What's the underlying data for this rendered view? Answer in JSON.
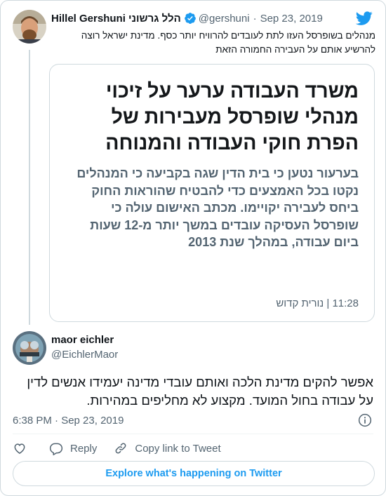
{
  "colors": {
    "accent": "#1d9bf0",
    "text": "#0f1419",
    "muted": "#536471",
    "border": "#cfd9de"
  },
  "parent_tweet": {
    "author_name": "Hillel Gershuni הלל גרשוני",
    "handle": "@gershuni",
    "date": "Sep 23, 2019",
    "text": "מנהלים בשופרסל העזו לתת לעובדים להרוויח יותר כסף. מדינת ישראל רוצה להרשיע אותם על העבירה החמורה הזאת",
    "link_card": {
      "title": "משרד העבודה ערער על זיכוי מנהלי שופרסל מעבירות של הפרת חוקי העבודה והמנוחה",
      "body": "בערעור נטען כי בית הדין שגה בקביעה כי המנהלים נקטו בכל האמצעים כדי להבטיח שהוראות החוק ביחס לעבירה יקויימו. מכתב האישום עולה כי שופרסל העסיקה עובדים במשך יותר מ-12 שעות ביום עבודה, במהלך שנת 2013",
      "meta": "11:28 | נורית קדוש"
    }
  },
  "reply_tweet": {
    "author_name": "maor eichler",
    "handle": "@EichlerMaor",
    "text": "אפשר להקים מדינת הלכה ואותם עובדי מדינה יעמידו אנשים לדין על עבודה בחול המועד. מקצוע לא מחליפים במהירות.",
    "timestamp": "6:38 PM · Sep 23, 2019"
  },
  "actions": {
    "reply_label": "Reply",
    "copy_link_label": "Copy link to Tweet"
  },
  "explore_button": {
    "label": "Explore what's happening on Twitter"
  },
  "icons": [
    "verified-badge-icon",
    "twitter-bird-icon",
    "info-icon",
    "heart-icon",
    "reply-icon",
    "link-icon"
  ]
}
